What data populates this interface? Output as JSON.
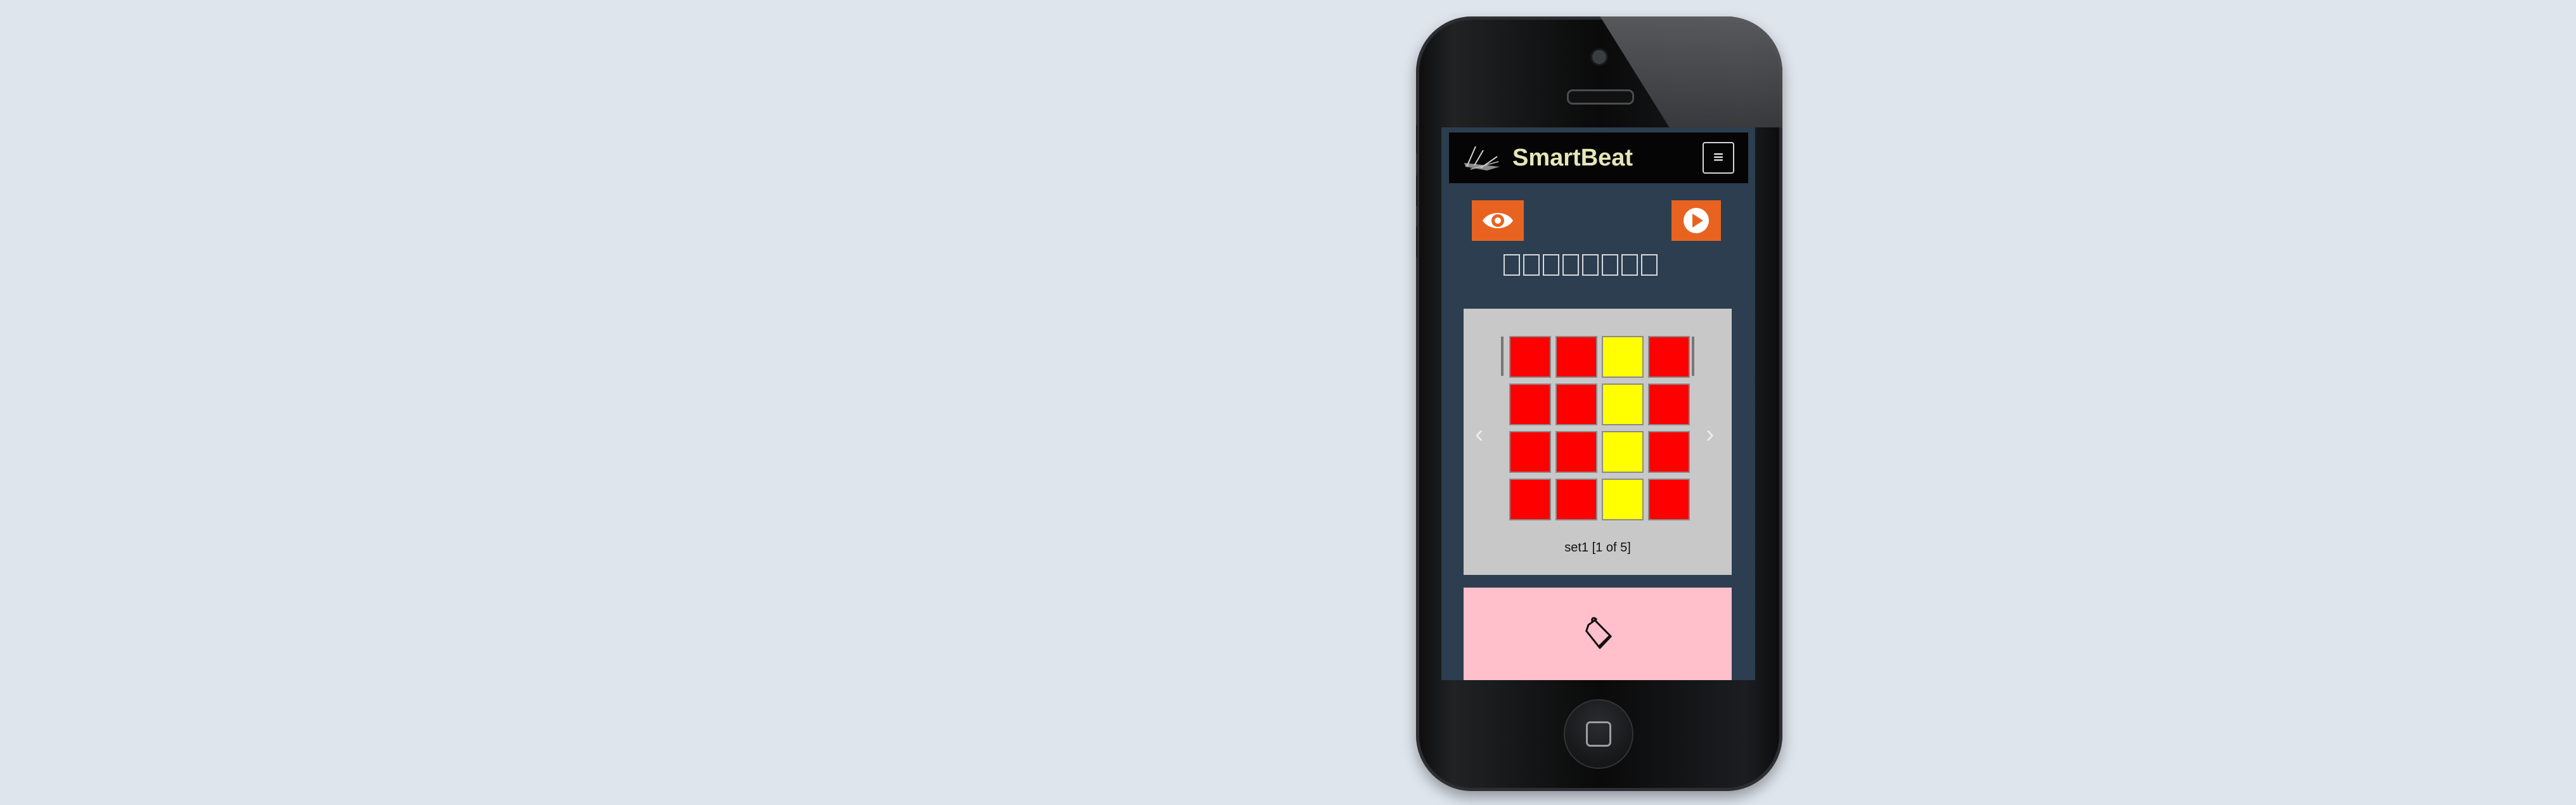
{
  "app": {
    "brand": "SmartBeat",
    "menu_glyph": "≡"
  },
  "toolbar": {
    "left_button_icon": "eye-icon",
    "right_button_icon": "play-icon",
    "accent_color": "#e8631f"
  },
  "beat_indicator": {
    "count": 8
  },
  "pad_grid": {
    "rows": 4,
    "cols": 4,
    "cells": [
      [
        "red",
        "red",
        "yellow",
        "red"
      ],
      [
        "red",
        "red",
        "yellow",
        "red"
      ],
      [
        "red",
        "red",
        "yellow",
        "red"
      ],
      [
        "red",
        "red",
        "yellow",
        "red"
      ]
    ],
    "colors": {
      "red": "#ff0000",
      "yellow": "#ffff00"
    },
    "set_label": "set1 [1 of 5]",
    "prev_glyph": "‹",
    "next_glyph": "›"
  },
  "sound_panel": {
    "icon": "cowbell-icon",
    "background": "#ffc0cb"
  }
}
